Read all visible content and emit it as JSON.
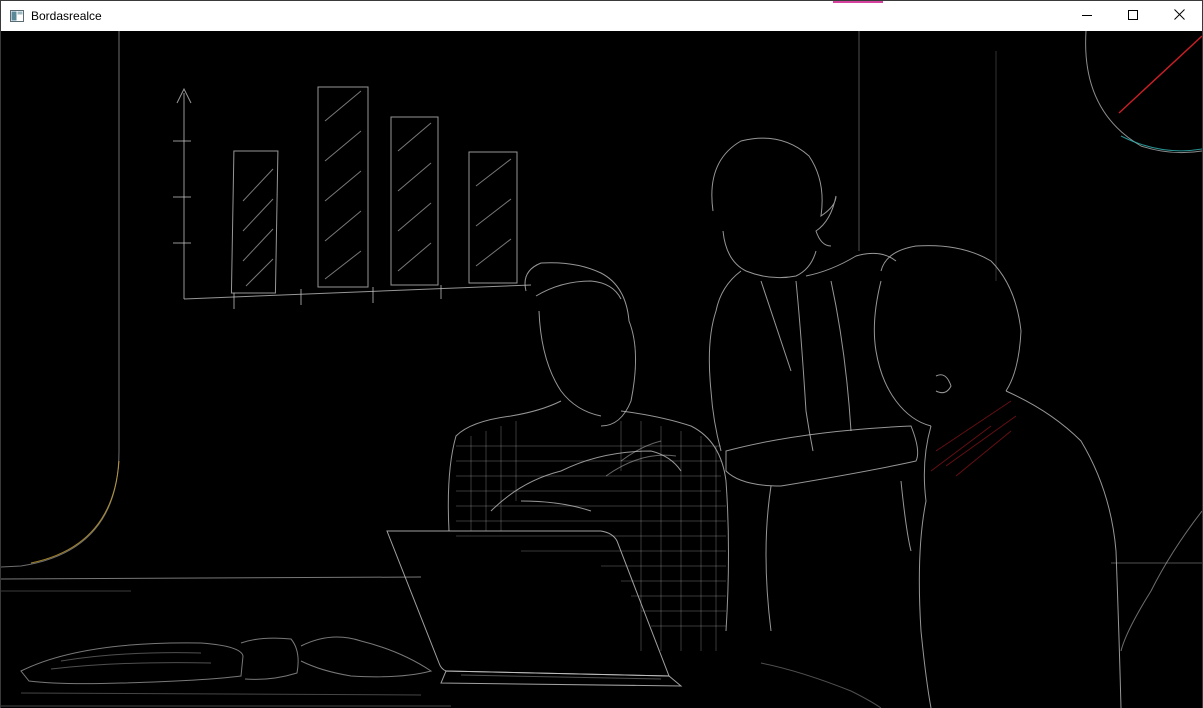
{
  "window": {
    "title": "Bordasrealce",
    "accent_color": "#d6409f",
    "icons": {
      "app": "app-window-icon",
      "minimize": "minimize-icon",
      "maximize": "maximize-icon",
      "close": "close-icon"
    }
  },
  "viewport": {
    "background": "#000000",
    "edge_colors": {
      "primary": "#c8c8c8",
      "warm": "#c9a233",
      "red": "#e0222a",
      "cyan": "#2fb7b7"
    }
  }
}
